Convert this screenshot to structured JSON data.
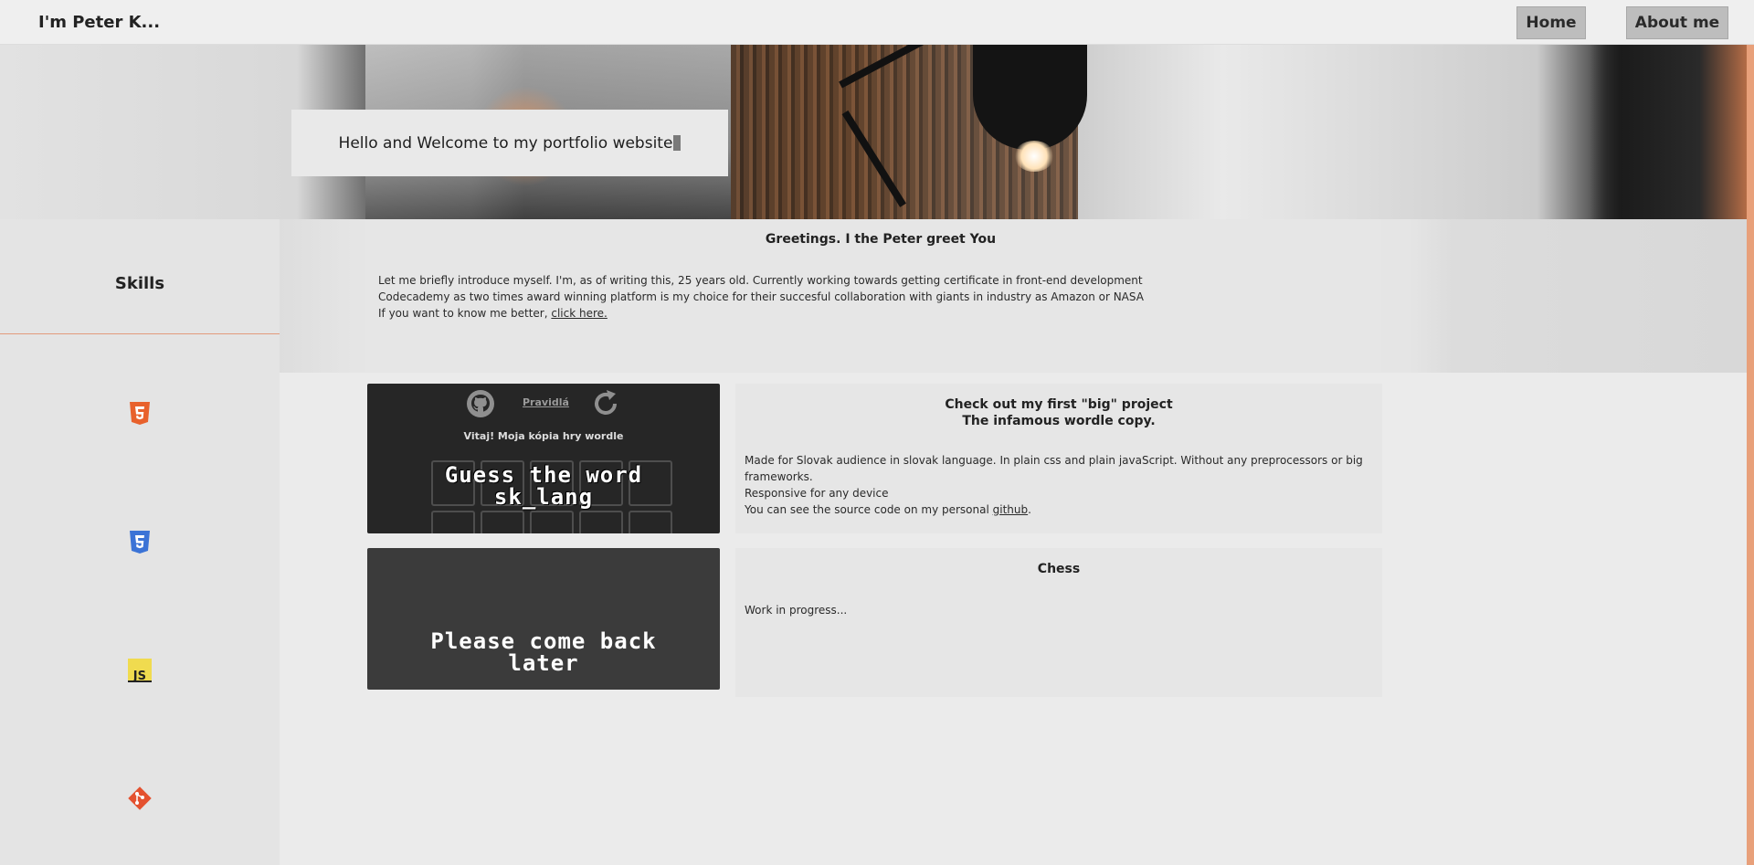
{
  "header": {
    "brand": "I'm Peter K...",
    "nav": {
      "home": "Home",
      "about": "About me"
    }
  },
  "hero": {
    "welcome": "Hello and Welcome to my portfolio website"
  },
  "sidebar": {
    "title": "Skills",
    "skills": [
      {
        "name": "html5-icon",
        "color": "#e8612c"
      },
      {
        "name": "css3-icon",
        "color": "#3b73d6"
      },
      {
        "name": "javascript-icon",
        "color": "#f0db4f"
      },
      {
        "name": "git-icon",
        "color": "#e4512f"
      }
    ]
  },
  "about": {
    "title": "Greetings. I the Peter greet You",
    "line1": "Let me briefly introduce myself. I'm, as of writing this, 25 years old. Currently working towards getting certificate in front-end development",
    "line2": "Codecademy as two times award winning platform is my choice for their succesful collaboration with giants in industry as Amazon or NASA",
    "line3_prefix": "If you want to know me better, ",
    "line3_link": "click here."
  },
  "projects": [
    {
      "thumb": {
        "rules_link": "Pravidlá",
        "welcome": "Vitaj! Moja kópia hry wordle",
        "overlay_line1": "Guess the word",
        "overlay_line2": "sk_lang"
      },
      "title_line1": "Check out my first \"big\" project",
      "title_line2": "The infamous wordle copy.",
      "text_line1": "Made for Slovak audience in slovak language. In plain css and plain javaScript. Without any preprocessors or big frameworks.",
      "text_line2": "Responsive for any device",
      "text_line3_prefix": "You can see the source code on my personal ",
      "text_line3_link": "github",
      "text_line3_suffix": "."
    },
    {
      "thumb": {
        "overlay_line1": "Please come back",
        "overlay_line2": "later"
      },
      "title": "Chess",
      "text": "Work in progress..."
    }
  ],
  "colors": {
    "accent": "#e29a7c",
    "nav_button": "#bdbdbd",
    "card_dark": "#262626"
  }
}
